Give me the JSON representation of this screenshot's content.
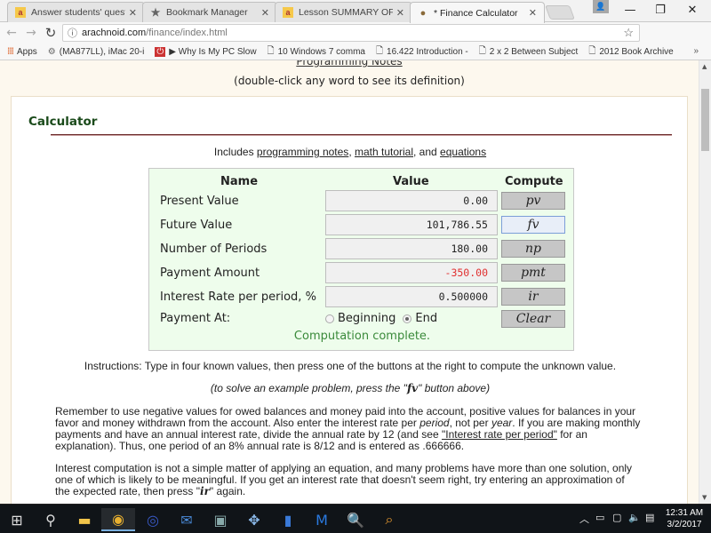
{
  "browser": {
    "tabs": [
      {
        "title": "Answer students' questio",
        "icon": "answers-favicon-icon",
        "active": false
      },
      {
        "title": "Bookmark Manager",
        "icon": "star-icon",
        "active": false
      },
      {
        "title": "Lesson SUMMARY OF FIN",
        "icon": "lesson-favicon-icon",
        "active": false
      },
      {
        "title": "* Finance Calculator",
        "icon": "arachnoid-favicon-icon",
        "active": true
      }
    ],
    "url_host": "arachnoid.com",
    "url_path": "/finance/index.html",
    "bookmarks": [
      {
        "label": "Apps",
        "icon": "apps-grid-icon"
      },
      {
        "label": "(MA877LL), iMac 20-i",
        "icon": "site-favicon-icon"
      },
      {
        "label": "▶ Why Is My PC Slow",
        "icon": "power-favicon-icon"
      },
      {
        "label": "10 Windows 7 comma",
        "icon": "page-icon"
      },
      {
        "label": "16.422 Introduction -",
        "icon": "page-icon"
      },
      {
        "label": "2 x 2 Between Subject",
        "icon": "page-icon"
      },
      {
        "label": "2012 Book Archive",
        "icon": "page-icon"
      }
    ]
  },
  "page": {
    "top_link": "Programming Notes",
    "dblclick_note": "(double-click any word to see its definition)",
    "card_title": "Calculator",
    "includes": {
      "prefix": "Includes ",
      "link1": "programming notes",
      "sep1": ", ",
      "link2": "math tutorial",
      "sep2": ", and ",
      "link3": "equations"
    },
    "calculator": {
      "headers": {
        "name": "Name",
        "value": "Value",
        "compute": "Compute"
      },
      "rows": [
        {
          "label": "Present Value",
          "value": "0.00",
          "button": "pv"
        },
        {
          "label": "Future Value",
          "value": "101,786.55",
          "button": "fv"
        },
        {
          "label": "Number of Periods",
          "value": "180.00",
          "button": "np"
        },
        {
          "label": "Payment Amount",
          "value": "-350.00",
          "button": "pmt"
        },
        {
          "label": "Interest Rate per period, %",
          "value": "0.500000",
          "button": "ir"
        }
      ],
      "payment_at_label": "Payment At:",
      "payment_options": [
        "Beginning",
        "End"
      ],
      "payment_selected": "End",
      "clear_label": "Clear",
      "status": "Computation complete.",
      "negative_color": "#e03030",
      "status_color": "#3a8a3a"
    },
    "instructions": "Instructions: Type in four known values, then press one of the buttons at the right to compute the unknown value.",
    "example": {
      "prefix": "(to solve an example problem, press the \"",
      "button": "fv",
      "suffix": "\" button above)"
    },
    "para1": {
      "t1": "Remember to use negative values for owed balances and money paid into the account, positive values for balances in your favor and money withdrawn from the account. Also enter the interest rate per ",
      "em1": "period",
      "t2": ", not per ",
      "em2": "year",
      "t3": ". If you are making monthly payments and have an annual interest rate, divide the annual rate by 12 (and see ",
      "link": "\"Interest rate per period\"",
      "t4": " for an explanation). Thus, one period of an 8% annual rate is 8/12 and is entered as .666666."
    },
    "para2": {
      "t1": "Interest computation is not a simple matter of applying an equation, and many problems have more than one solution, only one of which is likely to be meaningful. If you get an interest rate that doesn't seem right, try entering an approximation of the expected rate, then press \"",
      "ir": "ir",
      "t2": "\" again."
    }
  },
  "taskbar": {
    "time": "12:31 AM",
    "date": "3/2/2017"
  }
}
